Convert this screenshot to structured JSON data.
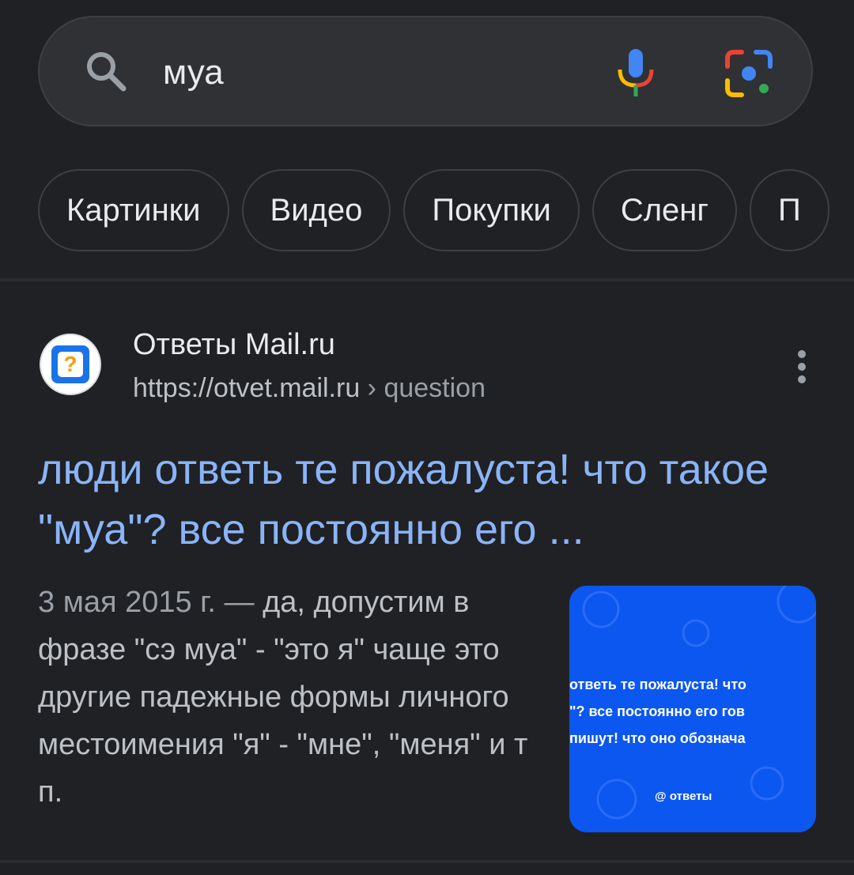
{
  "search": {
    "query": "муа"
  },
  "chips": [
    {
      "label": "Картинки"
    },
    {
      "label": "Видео"
    },
    {
      "label": "Покупки"
    },
    {
      "label": "Сленг"
    },
    {
      "label": "П"
    }
  ],
  "result": {
    "site_name": "Ответы Mail.ru",
    "url_base": "https://otvet.mail.ru",
    "url_crumb": " › question",
    "title": "люди ответь те пожалуста! что такое \"муа\"? все постоянно его ...",
    "snippet_date": "3 мая 2015 г. — ",
    "snippet_text": "да, допустим в фразе \"сэ муа\" - \"это я\" чаще это другие падежные формы личного местоимения \"я\" - \"мне\", \"меня\" и т п.",
    "thumbnail": {
      "line1": "ответь те пожалуста! что",
      "line2": "\"? все постоянно его гов",
      "line3": "пишут! что оно обозначa",
      "brand": "ответы"
    }
  },
  "colors": {
    "background": "#202124",
    "link": "#8ab4f8",
    "text": "#e8eaed",
    "thumbnail_bg": "#0b57f0"
  },
  "icons": {
    "search": "search-icon",
    "mic": "mic-icon",
    "lens": "lens-icon",
    "more": "more-vert-icon"
  }
}
